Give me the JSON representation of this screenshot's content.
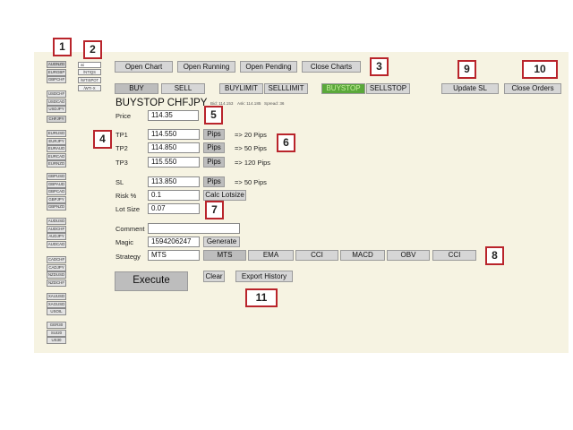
{
  "symbols": {
    "group1": [
      "AUDNZD",
      "EURGBP",
      "GBPCHF"
    ],
    "group2": [
      "USDCHF",
      "USDCAD",
      "USDJPY"
    ],
    "group3": [
      "CHFJPY"
    ],
    "group4": [
      "EURUSD",
      "EURJPY",
      "EURAUD",
      "EURCAD",
      "EURNZD"
    ],
    "group5": [
      "GBPUSD",
      "GBPAUD",
      "GBPCAD",
      "GBPJPY",
      "GBPNZD"
    ],
    "group6": [
      "AUDUSD",
      "AUDCHF",
      "AUDJPY",
      "AUDCAD"
    ],
    "group7": [
      "CADCHF",
      "CADJPY",
      "NZDUSD",
      "NZDCHF"
    ],
    "group8": [
      "XAUUSD",
      "XAGUSD",
      "USOIL"
    ],
    "group9": [
      "GER30",
      "SUI20",
      "US30"
    ]
  },
  "prefix": {
    "input_value": "wi",
    "items": [
      "/NTIQS",
      "/WTISPOT",
      "/WTI-X"
    ]
  },
  "toolbar": {
    "open_chart": "Open Chart",
    "open_running": "Open Running",
    "open_pending": "Open Pending",
    "close_charts": "Close Charts",
    "update_sl": "Update SL",
    "close_orders": "Close Orders"
  },
  "order_types": {
    "buy": "BUY",
    "sell": "SELL",
    "buylimit": "BUYLIMIT",
    "selllimit": "SELLLIMIT",
    "buystop": "BUYSTOP",
    "sellstop": "SELLSTOP"
  },
  "order": {
    "title": "BUYSTOP CHFJPY",
    "bid": "Bid: 114.153",
    "ask": "Ask: 114.185",
    "spread": "Spread: 36",
    "price_label": "Price",
    "price_value": "114.35",
    "tp1_label": "TP1",
    "tp1_value": "114.550",
    "tp1_info": "=> 20 Pips",
    "tp2_label": "TP2",
    "tp2_value": "114.850",
    "tp2_info": "=> 50 Pips",
    "tp3_label": "TP3",
    "tp3_value": "115.550",
    "tp3_info": "=> 120 Pips",
    "pips_label": "Pips",
    "sl_label": "SL",
    "sl_value": "113.850",
    "sl_info": "=> 50 Pips",
    "risk_label": "Risk %",
    "risk_value": "0.1",
    "calc_lotsize": "Calc Lotsize",
    "lot_label": "Lot Size",
    "lot_value": "0.07",
    "comment_label": "Comment",
    "comment_value": "",
    "magic_label": "Magic",
    "magic_value": "1594206247",
    "generate": "Generate",
    "strategy_label": "Strategy",
    "strategy_value": "MTS",
    "strategies": [
      "MTS",
      "EMA",
      "CCI",
      "MACD",
      "OBV",
      "CCI"
    ]
  },
  "actions": {
    "execute": "Execute",
    "clear": "Clear",
    "export_history": "Export History"
  },
  "callouts": [
    "1",
    "2",
    "3",
    "4",
    "5",
    "6",
    "7",
    "8",
    "9",
    "10",
    "11"
  ],
  "colors": {
    "panel_bg": "#f6f3e2",
    "callout_border": "#b9242b",
    "active_green": "#5aa83a"
  }
}
